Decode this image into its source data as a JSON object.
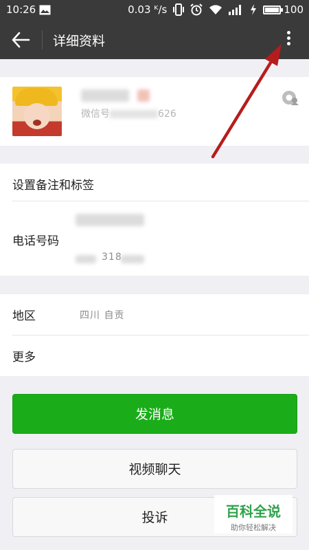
{
  "status_bar": {
    "time": "10:26",
    "speed": "0.03 ᴷ/s",
    "battery": "100",
    "battery_level": 1.0,
    "icons": [
      "image-icon",
      "vibrate-icon",
      "alarm-icon",
      "wifi-icon",
      "signal-icon",
      "charging-icon",
      "battery-icon"
    ]
  },
  "toolbar": {
    "title": "详细资料",
    "back_icon": "back-arrow-icon",
    "more_icon": "more-vertical-icon"
  },
  "profile": {
    "wechat_prefix": "微信号",
    "wechat_id_visible": "626"
  },
  "settings": {
    "remark_label": "设置备注和标签",
    "phone_label": "电话号码",
    "phone_visible": "318"
  },
  "info": {
    "region_label": "地区",
    "region_value": "四川 自贡",
    "more_label": "更多"
  },
  "buttons": {
    "send_message": "发消息",
    "video_chat": "视频聊天",
    "report": "投诉"
  },
  "watermark": {
    "title": "百科全说",
    "subtitle": "助你轻松解决"
  },
  "colors": {
    "header": "#3a3a3a",
    "primary_button": "#1aad19",
    "page_background": "#efeff4",
    "annotation_arrow": "#b71c1c",
    "watermark_green": "#2fa24a"
  }
}
